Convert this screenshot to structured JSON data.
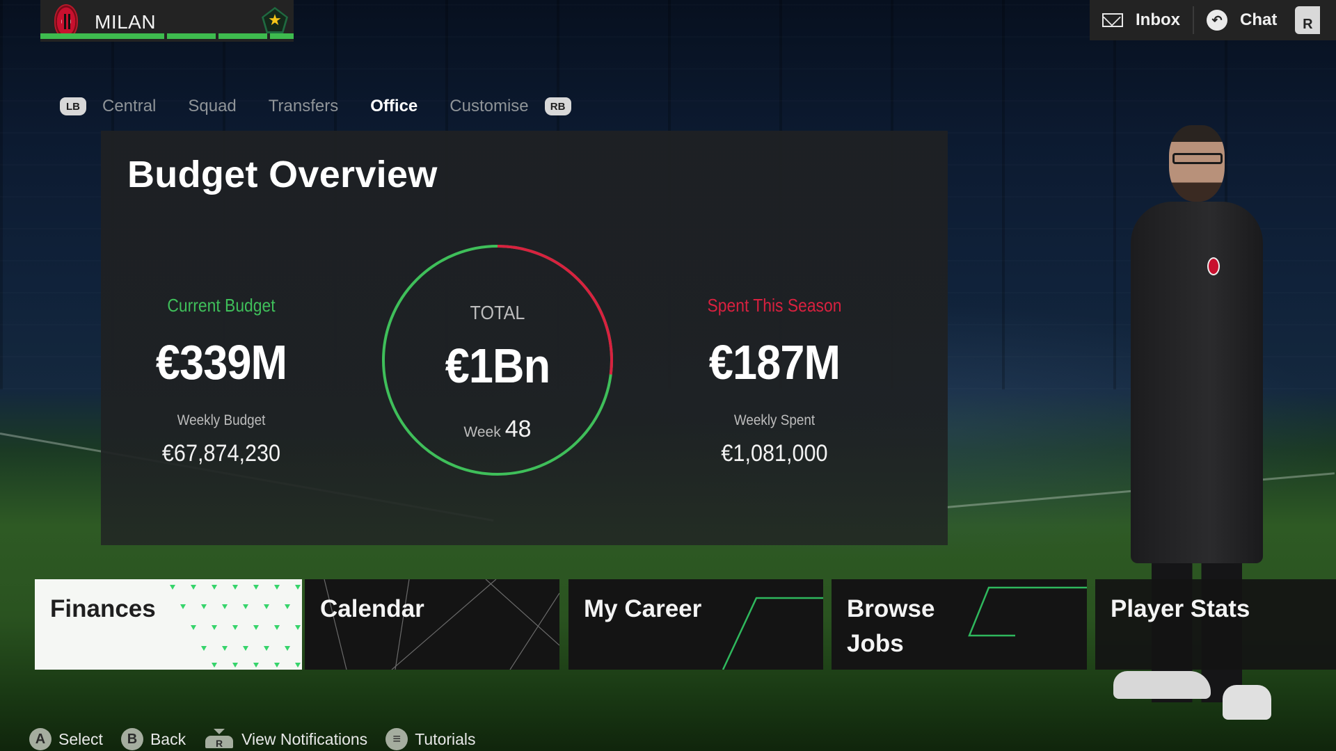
{
  "club": {
    "name": "MILAN",
    "crest_icon": "ac-milan-crest-icon",
    "rating_icon": "star-pentagon-icon",
    "progress_segments": 4
  },
  "top_right": {
    "inbox_label": "Inbox",
    "inbox_icon": "envelope-icon",
    "chat_label": "Chat",
    "chat_icon": "chat-bubble-icon",
    "extra_button": "R"
  },
  "tabs": {
    "left_bumper": "LB",
    "right_bumper": "RB",
    "items": [
      {
        "label": "Central",
        "active": false
      },
      {
        "label": "Squad",
        "active": false
      },
      {
        "label": "Transfers",
        "active": false
      },
      {
        "label": "Office",
        "active": true
      },
      {
        "label": "Customise",
        "active": false
      }
    ]
  },
  "budget": {
    "title": "Budget Overview",
    "current": {
      "label": "Current Budget",
      "value": "€339M",
      "weekly_label": "Weekly Budget",
      "weekly_value": "€67,874,230"
    },
    "total": {
      "label": "TOTAL",
      "value": "€1Bn",
      "week_label": "Week",
      "week_value": "48",
      "spent_fraction": 0.27
    },
    "spent": {
      "label": "Spent This Season",
      "value": "€187M",
      "weekly_label": "Weekly Spent",
      "weekly_value": "€1,081,000"
    },
    "colors": {
      "budget": "#3fbf5a",
      "spent": "#d8213f"
    }
  },
  "tiles": [
    {
      "label": "Finances",
      "active": true
    },
    {
      "label": "Calendar",
      "active": false
    },
    {
      "label": "My Career",
      "active": false
    },
    {
      "label": "Browse\nJobs",
      "active": false
    },
    {
      "label": "Player Stats",
      "active": false
    }
  ],
  "footer": [
    {
      "button": "A",
      "label": "Select"
    },
    {
      "button": "B",
      "label": "Back"
    },
    {
      "button": "R",
      "label": "View Notifications"
    },
    {
      "button": "≡",
      "label": "Tutorials"
    }
  ]
}
